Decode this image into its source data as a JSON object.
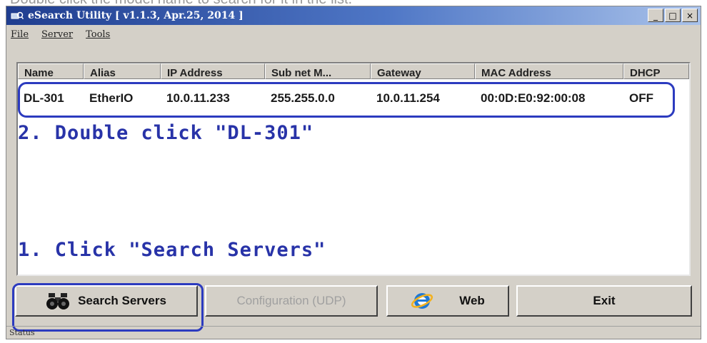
{
  "caption": "Double click the model name to search for it in the list.",
  "window": {
    "title": "eSearch Utility [ v1.1.3, Apr.25, 2014 ]",
    "controls": {
      "minimize": "_",
      "maximize": "□",
      "close": "×"
    }
  },
  "menu": [
    {
      "label": "File"
    },
    {
      "label": "Server"
    },
    {
      "label": "Tools"
    }
  ],
  "table": {
    "headers": [
      "Name",
      "Alias",
      "IP Address",
      "Sub net M...",
      "Gateway",
      "MAC Address",
      "DHCP"
    ],
    "rows": [
      [
        "DL-301",
        "EtherIO",
        "10.0.11.233",
        "255.255.0.0",
        "10.0.11.254",
        "00:0D:E0:92:00:08",
        "OFF"
      ]
    ]
  },
  "annotations": {
    "step2": "2. Double click \"DL-301\"",
    "step1": "1. Click \"Search Servers\"",
    "highlight_color": "#2c3bbf"
  },
  "buttons": {
    "search": {
      "label": "Search Servers",
      "icon": "binoculars-icon"
    },
    "config": {
      "label": "Configuration (UDP)",
      "disabled": true
    },
    "web": {
      "label": "Web",
      "icon": "ie-browser-icon"
    },
    "exit": {
      "label": "Exit"
    }
  },
  "status": "Status"
}
